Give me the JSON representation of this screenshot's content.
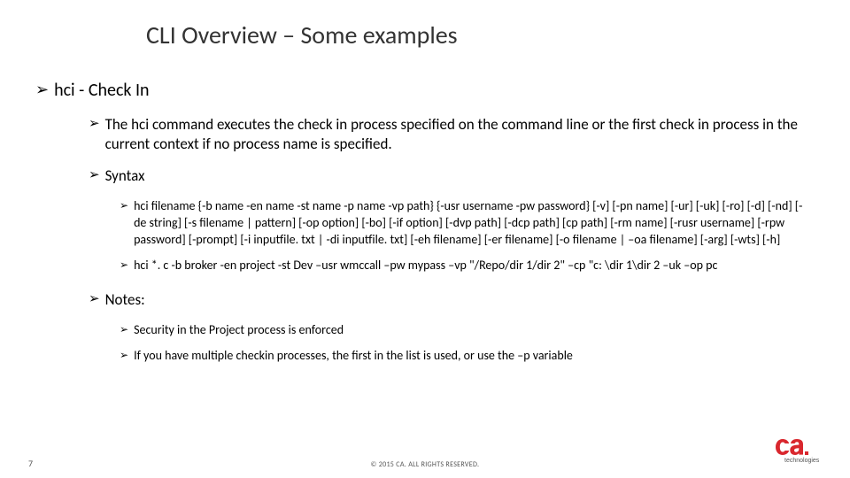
{
  "title": "CLI Overview – Some examples",
  "l1": {
    "heading": "hci - Check In"
  },
  "l2": {
    "desc": "The hci command executes the check in process specified on the command line or the first check in process in the current context if no process name is specified.",
    "syntax_label": "Syntax",
    "notes_label": "Notes:"
  },
  "l3": {
    "syntax1": "hci filename {-b name -en name -st name -p name -vp path} {-usr username -pw password} [-v] [-pn name] [-ur] [-uk] [-ro] [-d] [-nd] [-de string] [-s filename | pattern] [-op option] [-bo] [-if option] [-dvp path] [-dcp path] [cp path] [-rm name] [-rusr username] [-rpw password] [-prompt] [-i inputfile. txt | -di inputfile. txt] [-eh filename] [-er filename] [-o filename | –oa filename] [-arg] [-wts] [-h]",
    "syntax2": "hci *. c -b broker -en project -st Dev –usr wmccall –pw mypass –vp \"/Repo/dir 1/dir 2\" –cp \"c: \\dir 1\\dir 2 –uk –op pc",
    "note1": "Security in the Project process is enforced",
    "note2": "If you have multiple checkin processes, the first in the list is used, or use the –p variable"
  },
  "footer": {
    "page": "7",
    "copyright": "© 2015 CA. ALL RIGHTS RESERVED.",
    "logo_sub": "technologies"
  }
}
